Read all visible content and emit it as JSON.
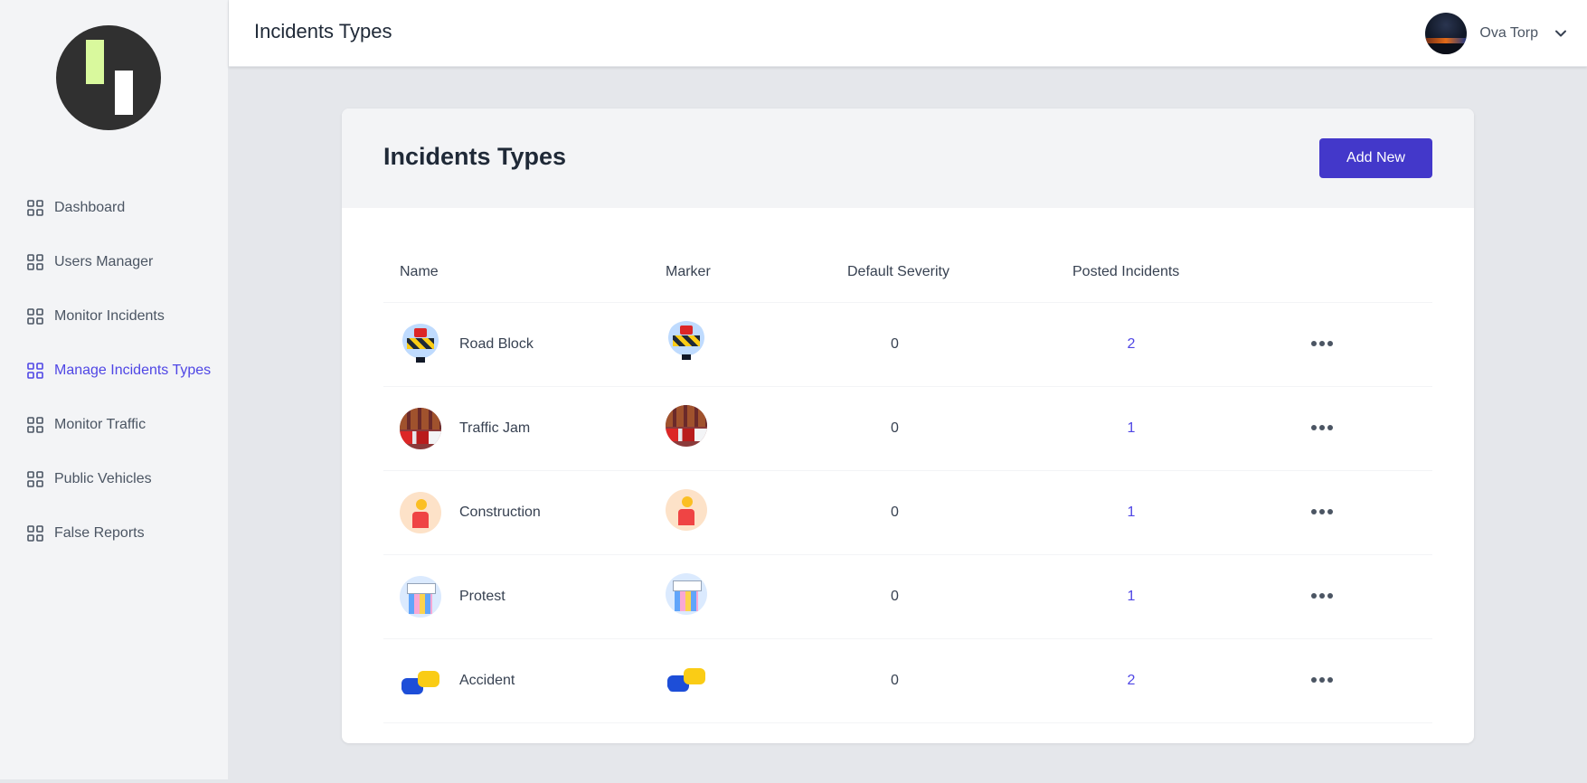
{
  "app": {
    "logo_icon": "brand-logo-icon"
  },
  "sidebar": {
    "items": [
      {
        "label": "Dashboard",
        "icon": "grid-icon",
        "active": false
      },
      {
        "label": "Users Manager",
        "icon": "grid-icon",
        "active": false
      },
      {
        "label": "Monitor Incidents",
        "icon": "grid-icon",
        "active": false
      },
      {
        "label": "Manage Incidents Types",
        "icon": "grid-icon",
        "active": true
      },
      {
        "label": "Monitor Traffic",
        "icon": "grid-icon",
        "active": false
      },
      {
        "label": "Public Vehicles",
        "icon": "grid-icon",
        "active": false
      },
      {
        "label": "False Reports",
        "icon": "grid-icon",
        "active": false
      }
    ]
  },
  "topbar": {
    "title": "Incidents Types",
    "user_name": "Ova Torp",
    "dropdown_icon": "chevron-down-icon"
  },
  "card": {
    "title": "Incidents Types",
    "add_button": "Add New"
  },
  "table": {
    "headers": {
      "name": "Name",
      "marker": "Marker",
      "severity": "Default Severity",
      "posted": "Posted Incidents"
    },
    "rows": [
      {
        "name": "Road Block",
        "icon": "road-block-icon",
        "severity": "0",
        "posted": "2"
      },
      {
        "name": "Traffic Jam",
        "icon": "traffic-jam-icon",
        "severity": "0",
        "posted": "1"
      },
      {
        "name": "Construction",
        "icon": "construction-icon",
        "severity": "0",
        "posted": "1"
      },
      {
        "name": "Protest",
        "icon": "protest-icon",
        "severity": "0",
        "posted": "1"
      },
      {
        "name": "Accident",
        "icon": "accident-icon",
        "severity": "0",
        "posted": "2"
      }
    ]
  },
  "colors": {
    "accent": "#4f46e5",
    "button": "#4338ca",
    "sidebar_bg": "#f3f4f6",
    "page_bg": "#e5e7eb"
  }
}
